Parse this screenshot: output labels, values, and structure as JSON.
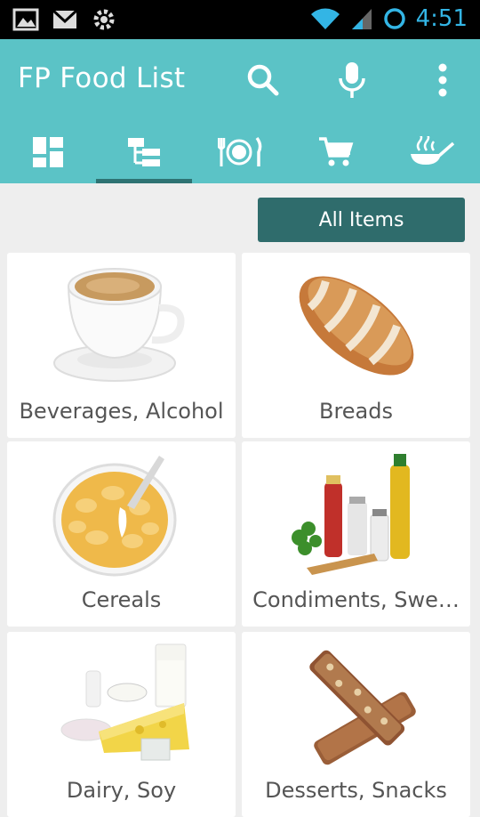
{
  "status_bar": {
    "time": "4:51",
    "left_icons": [
      "image-notification-icon",
      "gmail-notification-icon",
      "settings-update-icon"
    ],
    "right_icons": [
      "wifi-icon",
      "cell-signal-icon",
      "sync-icon"
    ]
  },
  "app_bar": {
    "title": "FP Food List",
    "actions": [
      "search-icon",
      "mic-icon",
      "overflow-menu-icon"
    ],
    "background": "#5bc3c6"
  },
  "tabs": [
    {
      "icon": "dashboard-icon",
      "active": false
    },
    {
      "icon": "category-tree-icon",
      "active": true
    },
    {
      "icon": "meal-icon",
      "active": false
    },
    {
      "icon": "shopping-cart-icon",
      "active": false
    },
    {
      "icon": "cooking-pan-icon",
      "active": false
    }
  ],
  "filter_button": {
    "label": "All Items",
    "color": "#2f6c6c"
  },
  "categories": [
    {
      "label": "Beverages, Alcohol",
      "icon": "coffee-cup-icon"
    },
    {
      "label": "Breads",
      "icon": "bread-loaf-icon"
    },
    {
      "label": "Cereals",
      "icon": "cereal-bowl-icon"
    },
    {
      "label": "Condiments, Swe…",
      "icon": "condiments-icon"
    },
    {
      "label": "Dairy, Soy",
      "icon": "dairy-icon"
    },
    {
      "label": "Desserts, Snacks",
      "icon": "snack-bar-icon"
    }
  ]
}
